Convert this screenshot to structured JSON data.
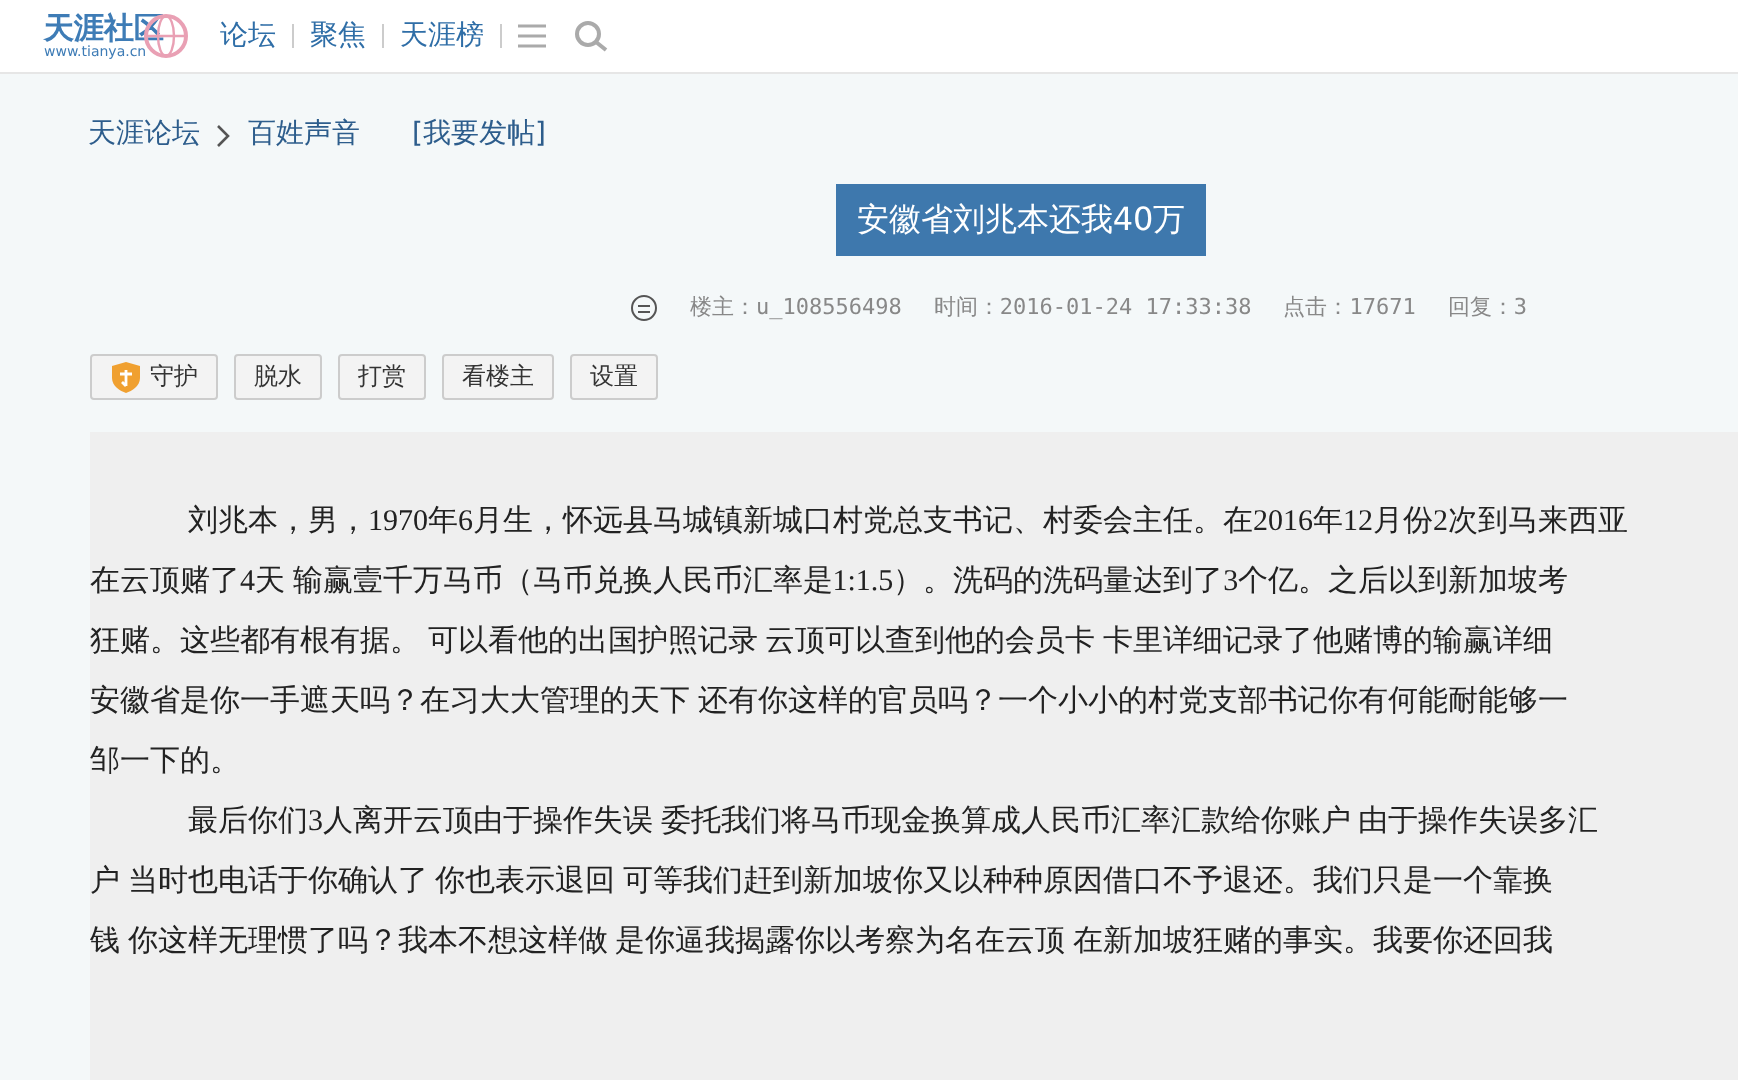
{
  "header": {
    "logo": {
      "title": "天涯社区",
      "url": "www.tianya.cn"
    },
    "nav": [
      "论坛",
      "聚焦",
      "天涯榜"
    ]
  },
  "breadcrumb": {
    "items": [
      "天涯论坛",
      "百姓声音"
    ],
    "action": "[我要发帖]"
  },
  "post": {
    "title": "安徽省刘兆本还我40万",
    "meta": [
      "楼主：u_108556498",
      "时间：2016-01-24 17:33:38",
      "点击：17671",
      "回复：3"
    ],
    "buttons": [
      {
        "label": "守护",
        "kind": "shield"
      },
      {
        "label": "脱水",
        "kind": "plain"
      },
      {
        "label": "打赏",
        "kind": "plain"
      },
      {
        "label": "看楼主",
        "kind": "plain"
      },
      {
        "label": "设置",
        "kind": "plain"
      }
    ],
    "paragraphs": [
      [
        "刘兆本，男，1970年6月生，怀远县马城镇新城口村党总支书记、村委会主任。在2016年12月份2次到马来西亚",
        "在云顶赌了4天 输赢壹千万马币（马币兑换人民币汇率是1:1.5）。洗码的洗码量达到了3个亿。之后以到新加坡考",
        "狂赌。这些都有根有据。  可以看他的出国护照记录 云顶可以查到他的会员卡 卡里详细记录了他赌博的输赢详细",
        "安徽省是你一手遮天吗？在习大大管理的天下 还有你这样的官员吗？一个小小的村党支部书记你有何能耐能够一",
        "邹一下的。"
      ],
      [
        "最后你们3人离开云顶由于操作失误 委托我们将马币现金换算成人民币汇率汇款给你账户 由于操作失误多汇",
        "户 当时也电话于你确认了 你也表示退回 可等我们赶到新加坡你又以种种原因借口不予退还。我们只是一个靠换",
        "钱 你这样无理惯了吗？我本不想这样做 是你逼我揭露你以考察为名在云顶 在新加坡狂赌的事实。我要你还回我"
      ]
    ]
  }
}
